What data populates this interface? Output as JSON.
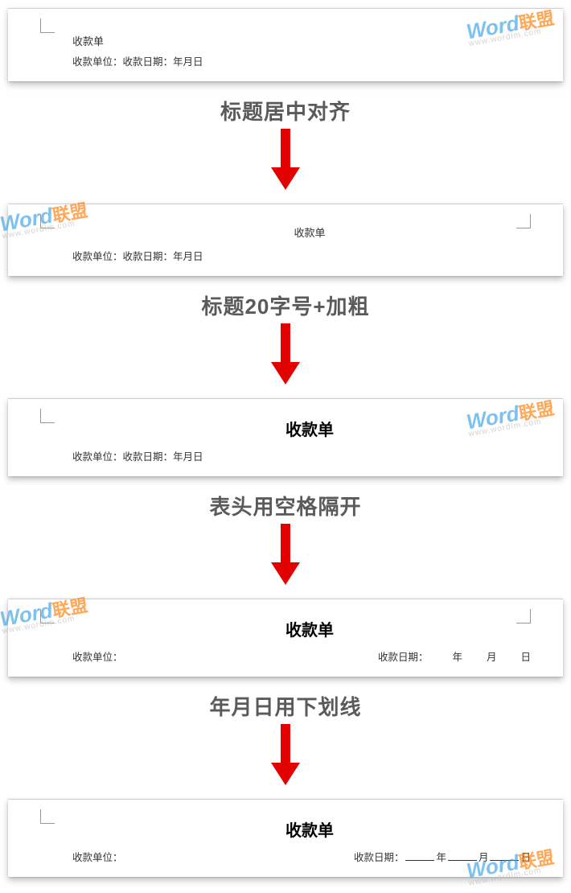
{
  "watermark": {
    "word": "Word",
    "lm": "联盟",
    "url": "www.wordlm.com"
  },
  "steps": {
    "s1": "标题居中对齐",
    "s2": "标题20字号+加粗",
    "s3": "表头用空格隔开",
    "s4": "年月日用下划线"
  },
  "panel1": {
    "title": "收款单",
    "sub": "收款单位：收款日期：年月日"
  },
  "panel2": {
    "title": "收款单",
    "sub": "收款单位：收款日期：年月日"
  },
  "panel3": {
    "title": "收款单",
    "sub": "收款单位：收款日期：年月日"
  },
  "panel4": {
    "title": "收款单",
    "left": "收款单位：",
    "right_label": "收款日期：",
    "y": "年",
    "m": "月",
    "d": "日"
  },
  "panel5": {
    "title": "收款单",
    "left": "收款单位：",
    "right_label": "收款日期：",
    "y": "年",
    "m": "月",
    "d": "日"
  }
}
